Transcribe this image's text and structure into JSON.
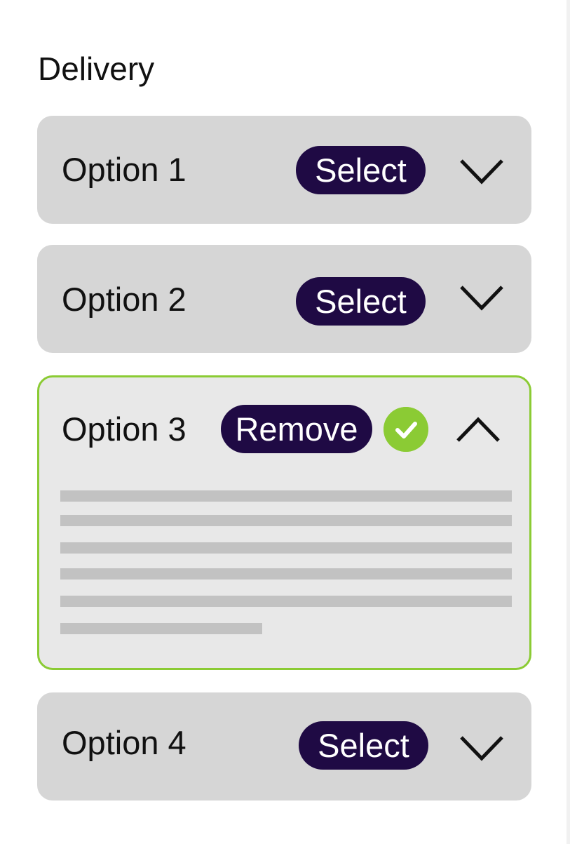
{
  "section": {
    "title": "Delivery"
  },
  "options": [
    {
      "label": "Option 1",
      "action": "Select",
      "state": "collapsed"
    },
    {
      "label": "Option 2",
      "action": "Select",
      "state": "collapsed"
    },
    {
      "label": "Option 3",
      "action": "Remove",
      "state": "expanded",
      "selected": true,
      "status_icon": "check-circle-icon",
      "body": "placeholder-text-lines"
    },
    {
      "label": "Option 4",
      "action": "Select",
      "state": "collapsed"
    }
  ],
  "colors": {
    "pill": "#1f0a44",
    "selected_border": "#8bcb34",
    "check": "#8bcb34",
    "card": "#d6d6d6",
    "card_expanded": "#e8e8e8"
  }
}
